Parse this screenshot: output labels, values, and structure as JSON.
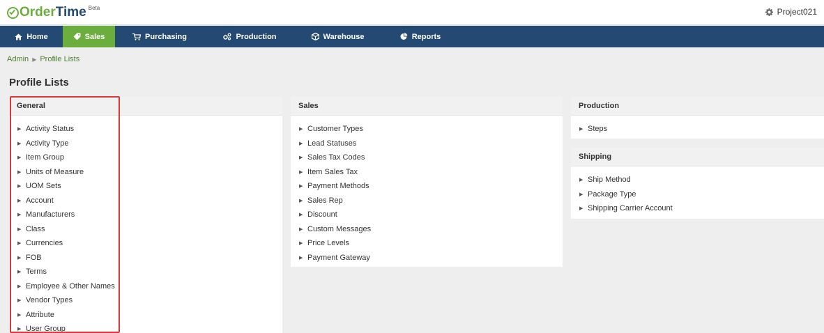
{
  "app": {
    "logo_part1": "Order",
    "logo_part2": "Time",
    "beta": "Beta",
    "project": "Project021"
  },
  "nav": [
    {
      "label": "Home",
      "icon": "home-icon"
    },
    {
      "label": "Sales",
      "icon": "tag-icon"
    },
    {
      "label": "Purchasing",
      "icon": "cart-icon"
    },
    {
      "label": "Production",
      "icon": "gears-icon"
    },
    {
      "label": "Warehouse",
      "icon": "box-icon"
    },
    {
      "label": "Reports",
      "icon": "pie-chart-icon"
    }
  ],
  "breadcrumb": {
    "parent": "Admin",
    "current": "Profile Lists"
  },
  "page_title": "Profile Lists",
  "panels": {
    "general": {
      "title": "General",
      "items": [
        "Activity Status",
        "Activity Type",
        "Item Group",
        "Units of Measure",
        "UOM Sets",
        "Account",
        "Manufacturers",
        "Class",
        "Currencies",
        "FOB",
        "Terms",
        "Employee & Other Names",
        "Vendor Types",
        "Attribute",
        "User Group"
      ]
    },
    "sales": {
      "title": "Sales",
      "items": [
        "Customer Types",
        "Lead Statuses",
        "Sales Tax Codes",
        "Item Sales Tax",
        "Payment Methods",
        "Sales Rep",
        "Discount",
        "Custom Messages",
        "Price Levels",
        "Payment Gateway"
      ]
    },
    "production": {
      "title": "Production",
      "items": [
        "Steps"
      ]
    },
    "shipping": {
      "title": "Shipping",
      "items": [
        "Ship Method",
        "Package Type",
        "Shipping Carrier Account"
      ]
    }
  },
  "colors": {
    "nav_bg": "#244a73",
    "active": "#6cae3e",
    "highlight": "#d9383a"
  }
}
